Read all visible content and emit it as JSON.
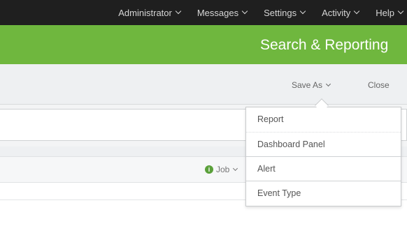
{
  "topnav": {
    "items": [
      {
        "label": "Administrator"
      },
      {
        "label": "Messages"
      },
      {
        "label": "Settings"
      },
      {
        "label": "Activity"
      },
      {
        "label": "Help"
      }
    ]
  },
  "appbar": {
    "title": "Search & Reporting"
  },
  "toolbar": {
    "save_as_label": "Save As",
    "close_label": "Close"
  },
  "jobbar": {
    "job_label": "Job"
  },
  "save_as_menu": {
    "items": [
      {
        "label": "Report"
      },
      {
        "label": "Dashboard Panel"
      },
      {
        "label": "Alert"
      },
      {
        "label": "Event Type"
      }
    ]
  },
  "colors": {
    "topnav_bg": "#1f1f1f",
    "appbar_bg": "#6fb73e",
    "info_green": "#5aa03a"
  }
}
